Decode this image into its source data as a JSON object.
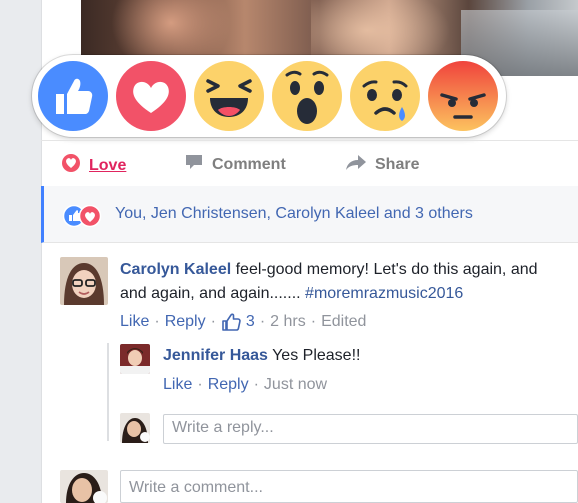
{
  "reactions": [
    {
      "name": "Like",
      "icon": "like-reaction-icon",
      "color": "#4080ff"
    },
    {
      "name": "Love",
      "icon": "love-reaction-icon",
      "color": "#f25268"
    },
    {
      "name": "Haha",
      "icon": "haha-reaction-icon",
      "color": "#fcd26a"
    },
    {
      "name": "Wow",
      "icon": "wow-reaction-icon",
      "color": "#fcd26a"
    },
    {
      "name": "Sad",
      "icon": "sad-reaction-icon",
      "color": "#fcd26a"
    },
    {
      "name": "Angry",
      "icon": "angry-reaction-icon",
      "color": "#f2724b"
    }
  ],
  "actions": {
    "love_label": "Love",
    "comment_label": "Comment",
    "share_label": "Share"
  },
  "summary": {
    "text": "You, Jen Christensen, Carolyn Kaleel and 3 others"
  },
  "comment": {
    "author": "Carolyn Kaleel",
    "text_line1": "feel-good memory! Let's do this again, and",
    "text_line2": "and again, and again.......",
    "hashtag": "#moremrazmusic2016",
    "like": "Like",
    "reply": "Reply",
    "like_count": "3",
    "time": "2 hrs",
    "edited": "Edited"
  },
  "reply": {
    "author": "Jennifer Haas",
    "text": "Yes Please!!",
    "like": "Like",
    "reply": "Reply",
    "time": "Just now"
  },
  "reply_input": {
    "placeholder": "Write a reply..."
  },
  "comment_input": {
    "placeholder": "Write a comment..."
  }
}
